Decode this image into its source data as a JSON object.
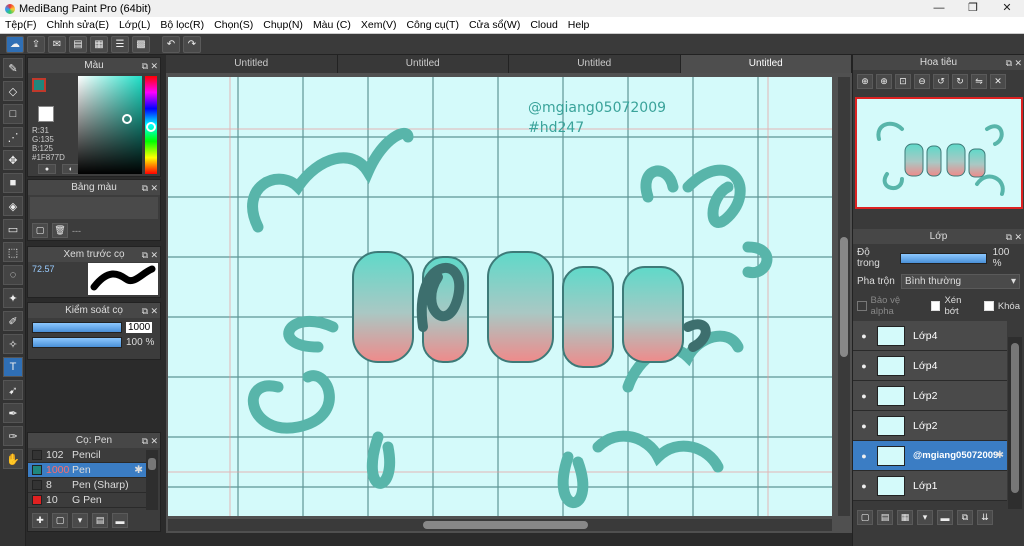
{
  "window": {
    "title": "MediBang Paint Pro (64bit)",
    "controls": [
      "—",
      "❐",
      "✕"
    ]
  },
  "menu": [
    "Tệp(F)",
    "Chỉnh sửa(E)",
    "Lớp(L)",
    "Bộ lọc(R)",
    "Chọn(S)",
    "Chụp(N)",
    "Màu (C)",
    "Xem(V)",
    "Công cụ(T)",
    "Cửa sổ(W)",
    "Cloud",
    "Help"
  ],
  "color_panel": {
    "title": "Màu",
    "r": "R:31",
    "g": "G:135",
    "b": "B:125",
    "hex": "#1F877D",
    "fg_color": "#1F877D"
  },
  "palette_panel": {
    "title": "Bảng màu",
    "value": "---"
  },
  "brush_preview": {
    "title": "Xem trước cọ",
    "size": "72.57"
  },
  "brush_control": {
    "title": "Kiểm soát cọ",
    "size": "1000",
    "opacity": "100 %"
  },
  "brush_list": {
    "title": "Cọ: Pen",
    "items": [
      {
        "size": "102",
        "name": "Pencil",
        "color": "#222222",
        "selected": false
      },
      {
        "size": "1000",
        "name": "Pen",
        "color": "#1F877D",
        "selected": true
      },
      {
        "size": "8",
        "name": "Pen (Sharp)",
        "color": "#222222",
        "selected": false
      },
      {
        "size": "10",
        "name": "G Pen",
        "color": "#e02020",
        "selected": false
      }
    ]
  },
  "tabs": [
    "Untitled",
    "Untitled",
    "Untitled",
    "Untitled"
  ],
  "canvas": {
    "watermark1": "@mgiang05072009",
    "watermark2": "#hd247"
  },
  "navigator": {
    "title": "Hoa tiêu"
  },
  "layers_panel": {
    "title": "Lớp",
    "opacity_label": "Độ trong",
    "opacity_value": "100 %",
    "blend_label": "Pha trộn",
    "blend_value": "Bình thường",
    "protect_alpha": "Bảo vệ alpha",
    "clipping": "Xén bớt",
    "lock": "Khóa",
    "layers": [
      {
        "name": "Lớp4",
        "selected": false
      },
      {
        "name": "Lớp4",
        "selected": false
      },
      {
        "name": "Lớp2",
        "selected": false
      },
      {
        "name": "Lớp2",
        "selected": false
      },
      {
        "name": "@mgiang05072009",
        "selected": true
      },
      {
        "name": "Lớp1",
        "selected": false
      }
    ]
  }
}
